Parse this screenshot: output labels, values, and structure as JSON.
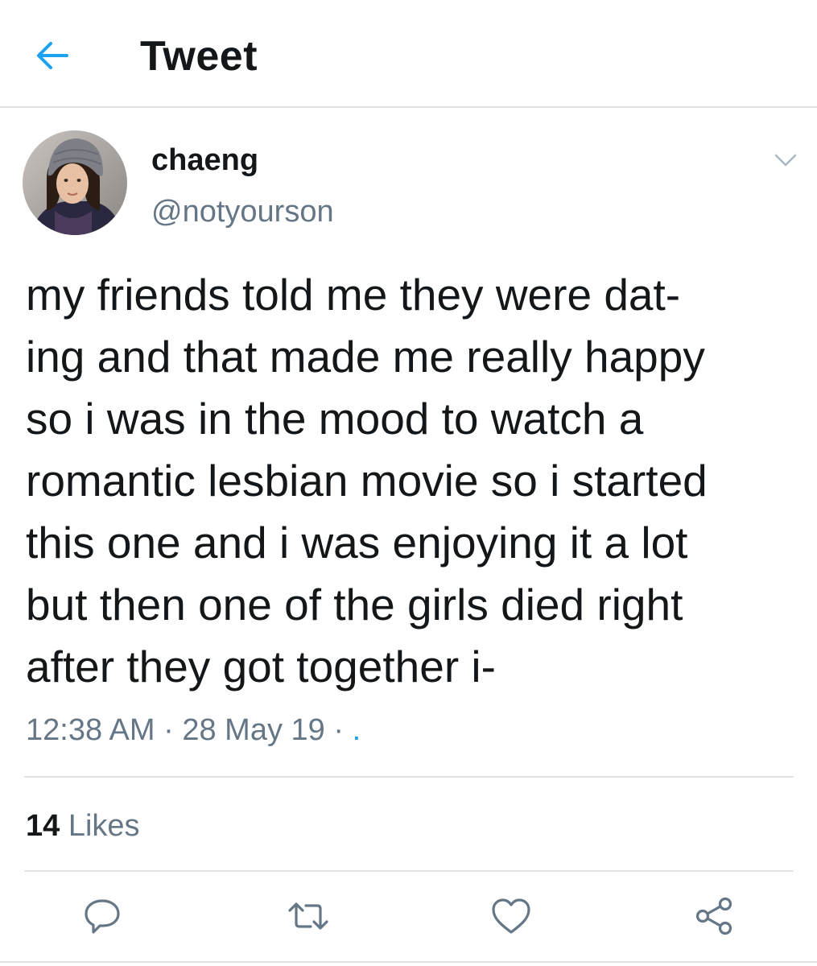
{
  "header": {
    "title": "Tweet",
    "back_icon": "back-arrow-icon",
    "accent_color": "#1da1f2"
  },
  "author": {
    "display_name": "chaeng",
    "handle": "@notyourson",
    "menu_icon": "chevron-down-icon"
  },
  "tweet": {
    "lines": [
      "my friends told me they were dat-",
      "ing and that made me really happy",
      "so i was in the mood to watch a",
      "romantic lesbian movie so i started",
      "this one and i was enjoying it a lot",
      "but then one of the girls died right",
      "after they got together i-"
    ],
    "time": "12:38 AM",
    "separator": " · ",
    "date": "28 May 19",
    "trailing_separator": " · ",
    "source": "."
  },
  "stats": {
    "likes_count": "14",
    "likes_label": "Likes"
  },
  "actions": [
    {
      "icon": "reply-icon"
    },
    {
      "icon": "retweet-icon"
    },
    {
      "icon": "like-heart-icon"
    },
    {
      "icon": "share-icon"
    }
  ],
  "colors": {
    "text": "#14171a",
    "secondary": "#657786",
    "divider": "#e1e5e8",
    "accent": "#1da1f2"
  }
}
